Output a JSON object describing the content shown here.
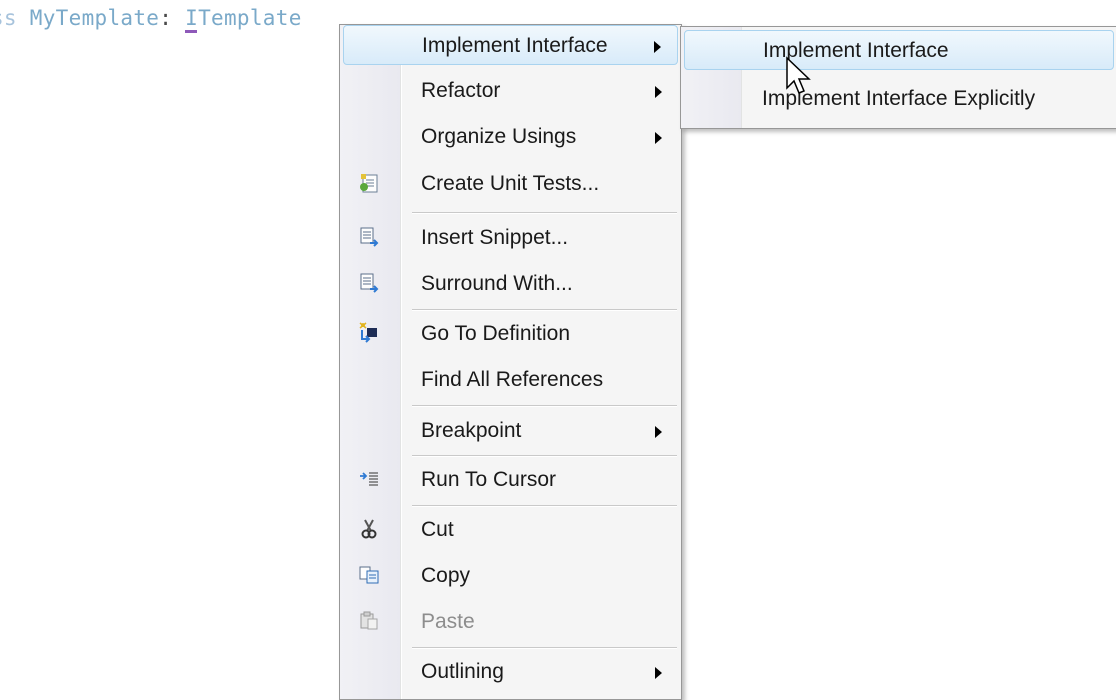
{
  "editor": {
    "code_prefix": "ass",
    "class_name": "MyTemplate",
    "colon": ":",
    "interface_first_letter": "I",
    "interface_rest": "Template"
  },
  "context_menu": {
    "items": [
      {
        "label": "Implement Interface",
        "submenu": true,
        "icon": ""
      },
      {
        "label": "Refactor",
        "submenu": true,
        "icon": ""
      },
      {
        "label": "Organize Usings",
        "submenu": true,
        "icon": ""
      },
      {
        "label": "Create Unit Tests...",
        "submenu": false,
        "icon": "unit-test-icon"
      },
      {
        "label": "Insert Snippet...",
        "submenu": false,
        "icon": "insert-snippet-icon"
      },
      {
        "label": "Surround With...",
        "submenu": false,
        "icon": "surround-with-icon"
      },
      {
        "label": "Go To Definition",
        "submenu": false,
        "icon": "go-to-definition-icon"
      },
      {
        "label": "Find All References",
        "submenu": false,
        "icon": ""
      },
      {
        "label": "Breakpoint",
        "submenu": true,
        "icon": ""
      },
      {
        "label": "Run To Cursor",
        "submenu": false,
        "icon": "run-to-cursor-icon"
      },
      {
        "label": "Cut",
        "submenu": false,
        "icon": "scissors-icon"
      },
      {
        "label": "Copy",
        "submenu": false,
        "icon": "copy-icon"
      },
      {
        "label": "Paste",
        "submenu": false,
        "icon": "paste-icon",
        "disabled": true
      },
      {
        "label": "Outlining",
        "submenu": true,
        "icon": ""
      }
    ]
  },
  "submenu": {
    "items": [
      {
        "label": "Implement Interface"
      },
      {
        "label": "Implement Interface Explicitly"
      }
    ]
  },
  "colors": {
    "highlight_border": "#a9d3ef",
    "menu_bg": "#f5f5f5",
    "code_text": "#7aa9c9",
    "smart_tag_underline": "#8e59b9"
  }
}
